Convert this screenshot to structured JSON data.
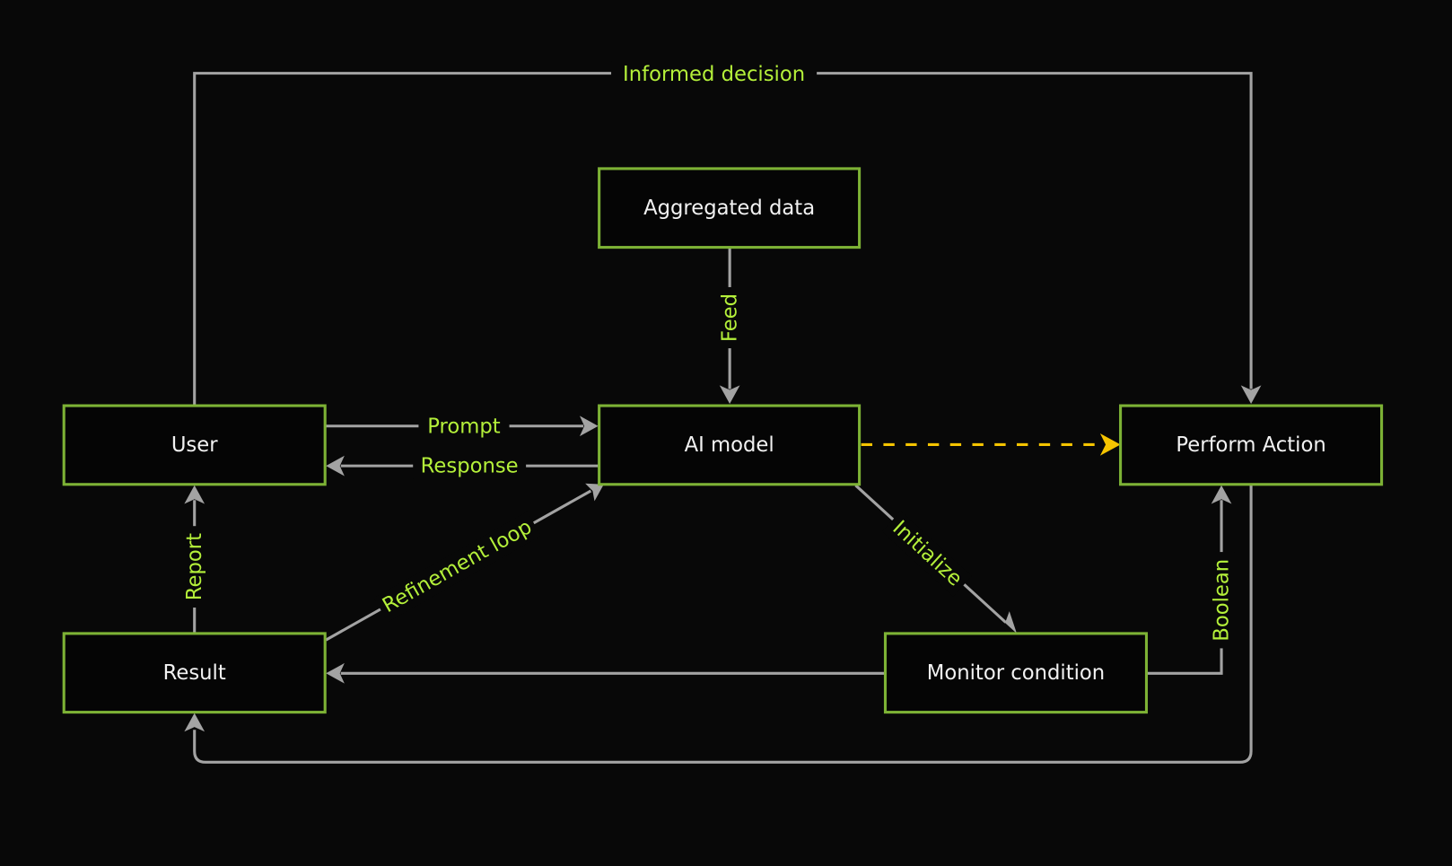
{
  "nodes": {
    "aggregated": "Aggregated data",
    "user": "User",
    "ai_model": "AI model",
    "perform": "Perform Action",
    "result": "Result",
    "monitor": "Monitor condition"
  },
  "edges": {
    "informed": "Informed decision",
    "feed": "Feed",
    "prompt": "Prompt",
    "response": "Response",
    "report": "Report",
    "refinement": "Refinement loop",
    "initialize": "Initialize",
    "boolean": "Boolean"
  },
  "colors": {
    "background": "#080808",
    "box_border": "#7db235",
    "label": "#b4f03a",
    "edge": "#a3a3a3",
    "dashed_edge": "#f5c400"
  }
}
